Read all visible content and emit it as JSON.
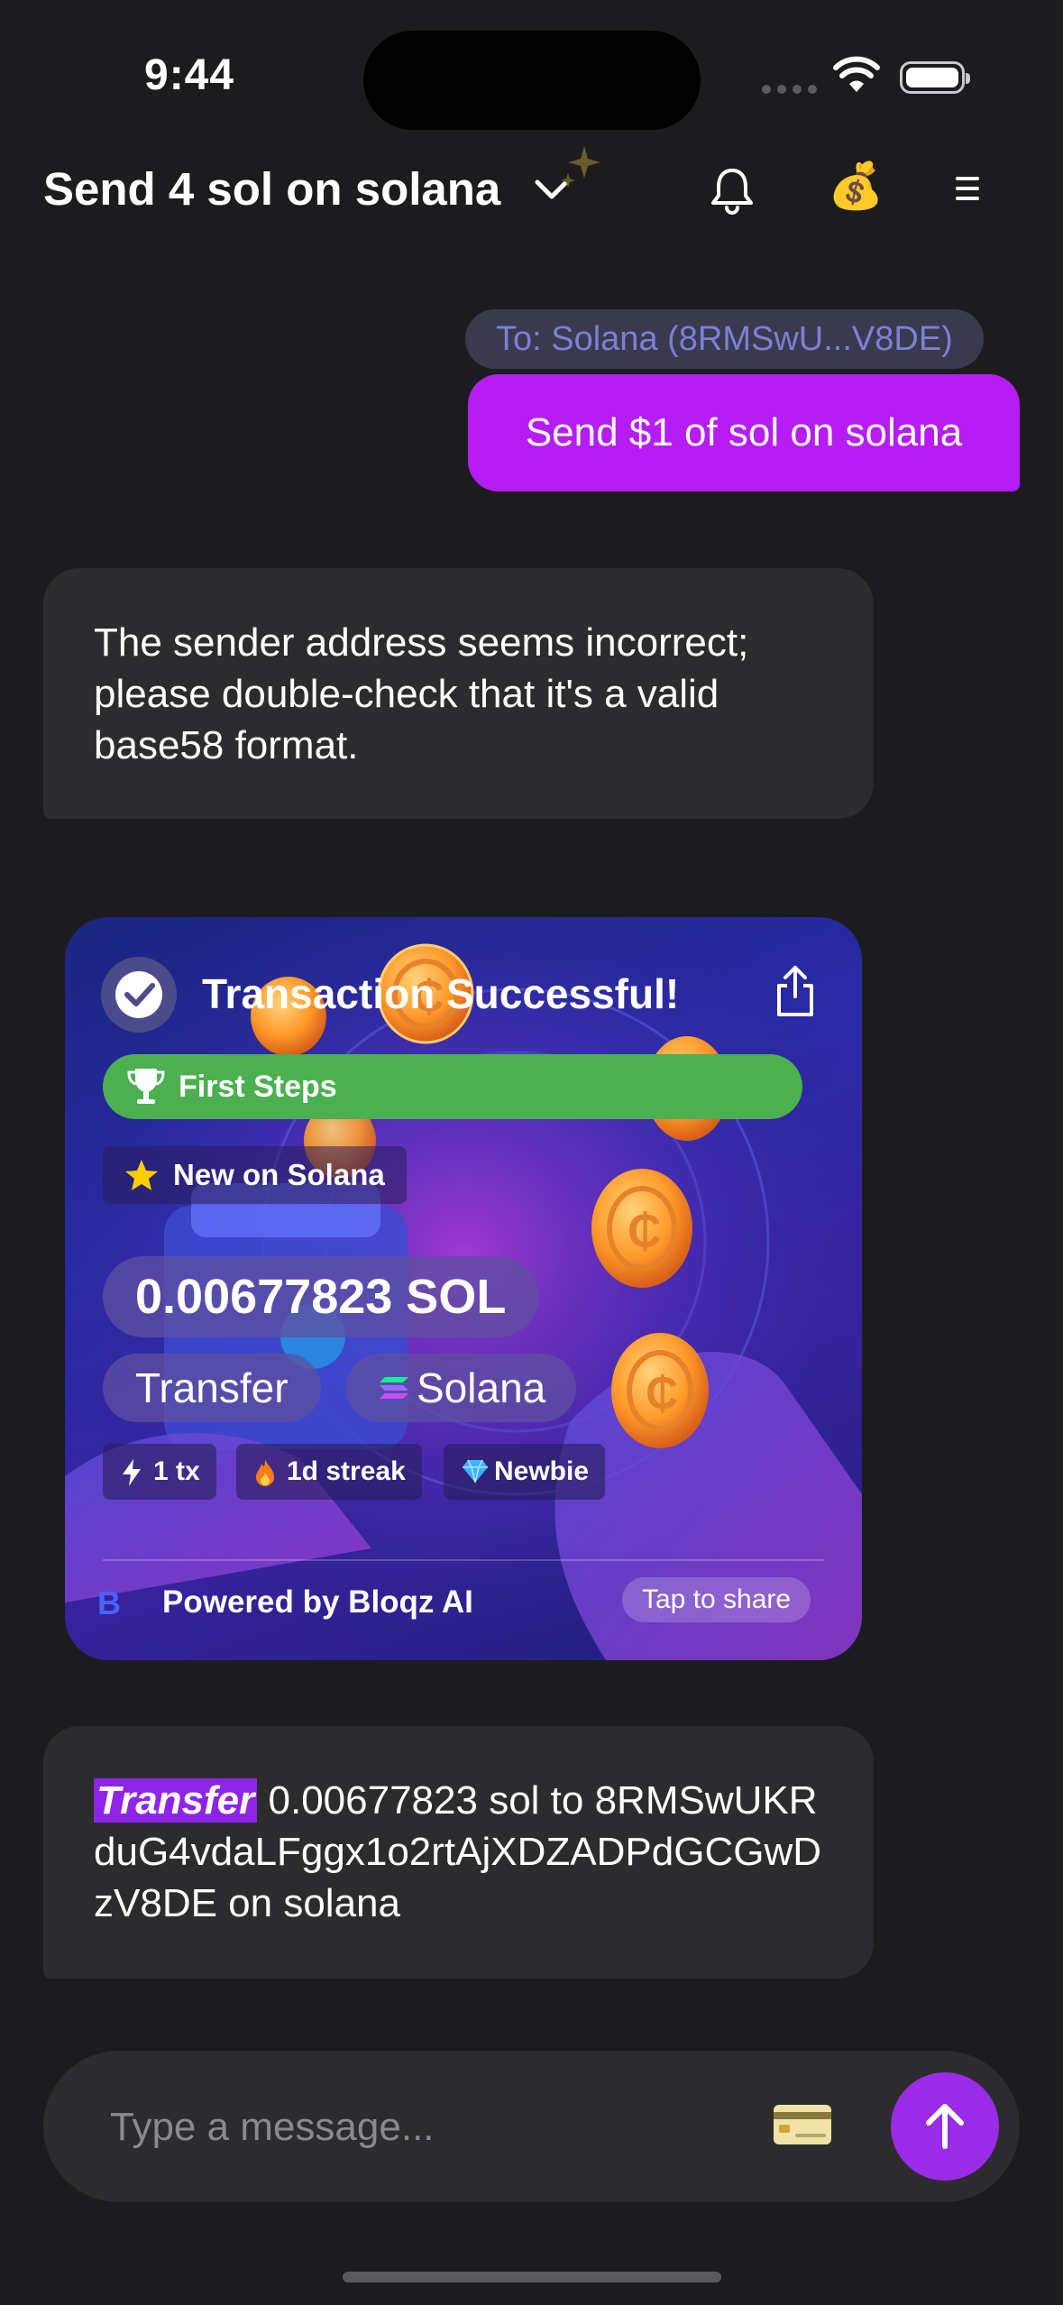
{
  "status_bar": {
    "time": "9:44"
  },
  "header": {
    "title": "Send 4 sol on solana",
    "money_emoji": "💰",
    "icons": [
      "chevron-down-icon",
      "sparkle-icon",
      "bell-icon",
      "money-bag-icon",
      "menu-icon"
    ]
  },
  "messages": {
    "user_recipient": "To: Solana (8RMSwU...V8DE)",
    "user_text": "Send $1 of sol on solana",
    "bot_text_1": "The sender address seems incorrect; please double-check that it's a valid base58 format.",
    "bot_text_2_tag": "Transfer",
    "bot_text_2_rest": " 0.00677823 sol to 8RMSwUKRduG4vdaLFggx1o2rtAjXDZADPdGCGwDzV8DE on solana"
  },
  "card": {
    "title": "Transaction Successful!",
    "achievement": "First Steps",
    "badge": "New on Solana",
    "amount": "0.00677823 SOL",
    "type": "Transfer",
    "network": "Solana",
    "stats": {
      "tx": "1 tx",
      "streak": "1d streak",
      "rank": "Newbie"
    },
    "brand_logo": "B",
    "powered_by": "Powered by Bloqz AI",
    "share_hint": "Tap to share",
    "colors": {
      "achievement": "#4caf50",
      "brand": "#4a63ff"
    }
  },
  "composer": {
    "placeholder": "Type a message..."
  },
  "colors": {
    "user_bubble": "#b61cf3",
    "send_button": "#9a2be6",
    "tag": "#8e24e8"
  }
}
